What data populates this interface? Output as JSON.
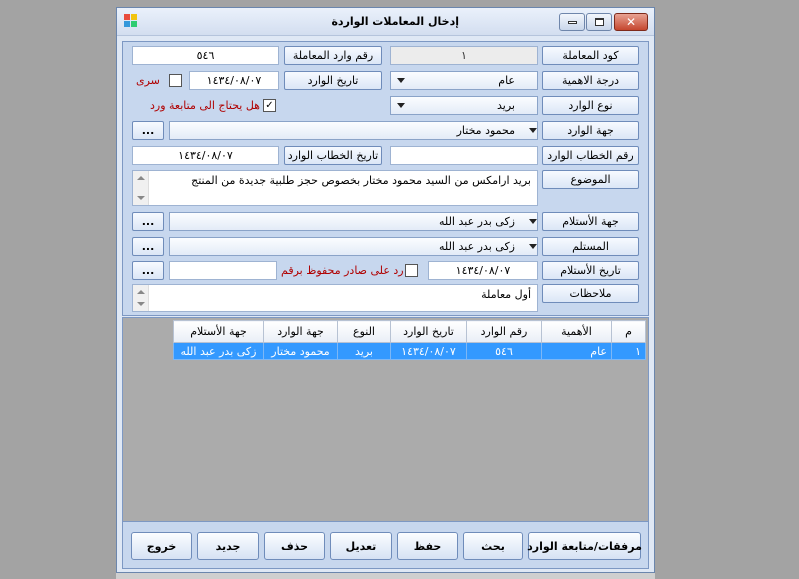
{
  "window": {
    "title": "إدخال المعاملات الواردة",
    "close_glyph": "✕"
  },
  "form": {
    "transaction_code": {
      "label": "كود المعاملة",
      "value": "١"
    },
    "incoming_number": {
      "label": "رقم وارد المعاملة",
      "value": "٥٤٦"
    },
    "importance": {
      "label": "درجة الاهمية",
      "value": "عام"
    },
    "incoming_date": {
      "label": "تاريخ الوارد",
      "value": "١٤٣٤/٠٨/٠٧"
    },
    "secret": {
      "label": "سرى",
      "checked": false
    },
    "incoming_type": {
      "label": "نوع الوارد",
      "value": "بريد"
    },
    "needs_followup": {
      "label": "هل يحتاج الى متابعة ورد",
      "checked": true
    },
    "incoming_party": {
      "label": "جهة الوارد",
      "value": "محمود مختار",
      "ellipsis": "..."
    },
    "letter_number": {
      "label": "رقم الخطاب الوارد",
      "value": ""
    },
    "letter_date": {
      "label": "تاريخ الخطاب الوارد",
      "value": "١٤٣٤/٠٨/٠٧"
    },
    "subject": {
      "label": "الموضوع",
      "value": "بريد ارامكس من السيد محمود مختار بخصوص حجز طلبية جديدة من المنتج"
    },
    "receiving_party": {
      "label": "جهة الأستلام",
      "value": "زكى بدر عبد الله",
      "ellipsis": "..."
    },
    "recipient": {
      "label": "المستلم",
      "value": "زكى بدر عبد الله",
      "ellipsis": "..."
    },
    "receipt_date": {
      "label": "تاريخ الأستلام",
      "value": "١٤٣٤/٠٨/٠٧"
    },
    "reply_saved": {
      "label": "رد على صادر محفوظ برقم",
      "checked": false,
      "value": "",
      "ellipsis": "..."
    },
    "notes": {
      "label": "ملاحظات",
      "value": "أول معاملة"
    }
  },
  "grid": {
    "columns": [
      "م",
      "الأهمية",
      "رقم الوارد",
      "تاريخ الوارد",
      "النوع",
      "جهة الوارد",
      "جهة الأستلام"
    ],
    "rows": [
      [
        "١",
        "عام",
        "٥٤٦",
        "١٤٣٤/٠٨/٠٧",
        "بريد",
        "محمود مختار",
        "زكى بدر عبد الله"
      ]
    ]
  },
  "buttons": {
    "attachments": "مرفقات/متابعة الوارد",
    "search": "بحث",
    "save": "حفظ",
    "edit": "تعديل",
    "delete": "حذف",
    "new": "جديد",
    "exit": "خروج"
  },
  "colors": {
    "selection": "#3399ff",
    "required_text": "#b00000",
    "panel": "#c7d7ee"
  }
}
